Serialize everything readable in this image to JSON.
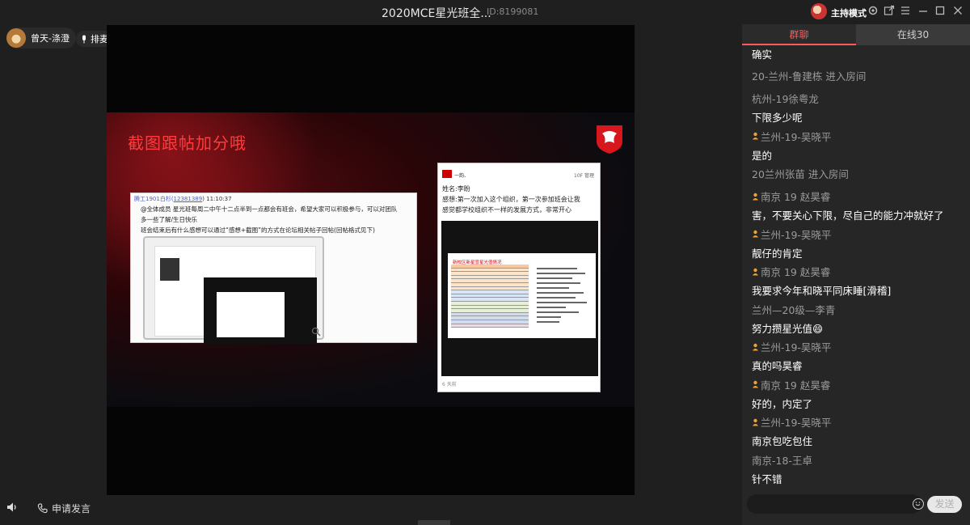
{
  "window": {
    "title": "2020MCE星光班全...",
    "room_id": "ID:8199081",
    "host_mode": "主持模式"
  },
  "user": {
    "name": "曾天-涤澄",
    "queue_label": "排麦"
  },
  "slide": {
    "title": "截图跟帖加分哦",
    "shot1": {
      "header_name": "腾工1901白杉(",
      "header_id": "12381389",
      "header_time": ") 11:10:37",
      "lines": [
        "@全体成员 星光班每周二中午十二点半到一点都会有班会，希望大家可以积极参与，可以对团队",
        "多一些了解/生日快乐",
        "班会结束后有什么感想可以通过“感想+截图”的方式在论坛相关帖子回帖(回帖格式见下)"
      ]
    },
    "shot2": {
      "user": "一韵、",
      "actions": "10F  管理",
      "lines": [
        "姓名:李盼",
        "感想:第一次加入这个组织，第一次参加班会让我",
        "感觉都学校组织不一样的发展方式，非常开心"
      ],
      "mini_title": "新校区新星宣星光值情况",
      "time": "6 天前"
    }
  },
  "controls": {
    "apply_speak": "申请发言"
  },
  "chat": {
    "tabs": [
      "群聊",
      "在线30"
    ],
    "items": [
      {
        "type": "text",
        "text": "确实"
      },
      {
        "type": "sys",
        "text": "20-兰州-鲁建栋 进入房间"
      },
      {
        "type": "msg",
        "name": "杭州-19徐粤龙",
        "crown": false,
        "text": "下限多少呢"
      },
      {
        "type": "msg",
        "name": "兰州-19-吴晓平",
        "crown": true,
        "text": "是的"
      },
      {
        "type": "sys",
        "text": "20兰州张苗 进入房间"
      },
      {
        "type": "msg",
        "name": "南京 19 赵昊睿",
        "crown": true,
        "text": "害，不要关心下限，尽自己的能力冲就好了"
      },
      {
        "type": "msg",
        "name": "兰州-19-吴晓平",
        "crown": true,
        "text": "靓仔的肯定"
      },
      {
        "type": "msg",
        "name": "南京 19 赵昊睿",
        "crown": true,
        "text": "我要求今年和晓平同床睡[滑稽]"
      },
      {
        "type": "msg",
        "name": "兰州—20级—李青",
        "crown": false,
        "text": "努力攒星光值😄"
      },
      {
        "type": "msg",
        "name": "兰州-19-吴晓平",
        "crown": true,
        "text": "真的吗昊睿"
      },
      {
        "type": "msg",
        "name": "南京 19 赵昊睿",
        "crown": true,
        "text": "好的，内定了"
      },
      {
        "type": "msg",
        "name": "兰州-19-吴晓平",
        "crown": true,
        "text": "南京包吃包住"
      },
      {
        "type": "msg",
        "name": "南京-18-王卓",
        "crown": false,
        "text": "针不错"
      }
    ],
    "send_label": "发送"
  },
  "colors": {
    "accent": "#ff5a5a",
    "crown": "#f0a030"
  }
}
